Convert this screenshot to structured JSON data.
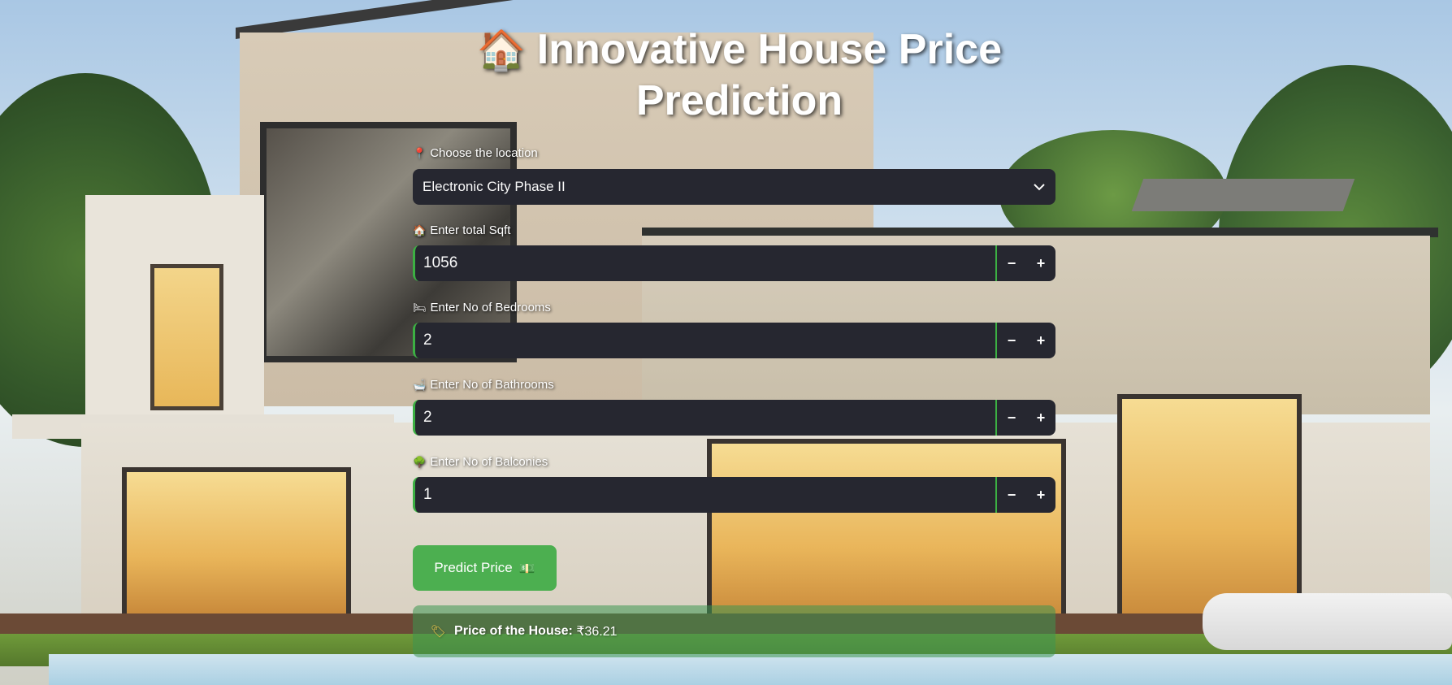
{
  "app": {
    "title_icon": "house-emoji",
    "title": "Innovative House Price Prediction"
  },
  "form": {
    "location": {
      "icon": "pin-icon",
      "label": "Choose the location",
      "value": "Electronic City Phase II"
    },
    "sqft": {
      "icon": "house-icon",
      "label": "Enter total Sqft",
      "value": "1056"
    },
    "bedrooms": {
      "icon": "bed-icon",
      "label": "Enter No of Bedrooms",
      "value": "2"
    },
    "bathrooms": {
      "icon": "bathtub-icon",
      "label": "Enter No of Bathrooms",
      "value": "2"
    },
    "balconies": {
      "icon": "tree-icon",
      "label": "Enter No of Balconies",
      "value": "1"
    },
    "stepper": {
      "minus": "−",
      "plus": "+"
    }
  },
  "predict_button": {
    "label": "Predict Price",
    "icon": "money-icon"
  },
  "result": {
    "icon": "tag-icon",
    "label": "Price of the House:",
    "value": "₹36.21"
  },
  "colors": {
    "input_bg": "#262730",
    "accent_green": "#4caf50",
    "focus_border": "#3cb043"
  }
}
